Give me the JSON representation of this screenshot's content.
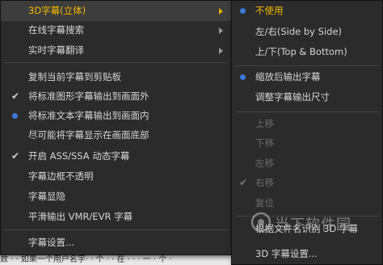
{
  "background_strip": {
    "text": "数 ·   ·   如果一个用户名字·  ·  个   ·   · 在  ·  ·  · 一 · 个 ·"
  },
  "main_menu": {
    "items": [
      {
        "label": "3D字幕(立体)",
        "has_arrow": true,
        "state": "highlighted"
      },
      {
        "label": "在线字幕搜索",
        "has_arrow": true
      },
      {
        "label": "实时字幕翻译",
        "has_arrow": true
      },
      {
        "label": "复制当前字幕到剪贴板"
      },
      {
        "label": "将标准图形字幕输出到画面外",
        "mark": "check"
      },
      {
        "label": "将标准文本字幕输出到画面内",
        "mark": "radio"
      },
      {
        "label": "尽可能将字幕显示在画面底部"
      },
      {
        "label": "开启 ASS/SSA 动态字幕",
        "mark": "check"
      },
      {
        "label": "字幕边框不透明"
      },
      {
        "label": "字幕显隐"
      },
      {
        "label": "平滑输出 VMR/EVR 字幕"
      },
      {
        "label": "字幕设置..."
      }
    ]
  },
  "sub_menu": {
    "items": [
      {
        "label": "不使用",
        "mark": "radio",
        "state": "selected"
      },
      {
        "label": "左/右(Side by Side)"
      },
      {
        "label": "上/下(Top & Bottom)"
      },
      {
        "label": "缩放后输出字幕",
        "mark": "radio"
      },
      {
        "label": "调整字幕输出尺寸"
      },
      {
        "label": "上移",
        "state": "disabled"
      },
      {
        "label": "下移",
        "state": "disabled"
      },
      {
        "label": "左移",
        "state": "disabled"
      },
      {
        "label": "右移",
        "state": "disabled",
        "mark": "check"
      },
      {
        "label": "复位",
        "state": "disabled"
      },
      {
        "label": "根据文件名识别 3D 字幕"
      },
      {
        "label": "3D 字幕设置..."
      }
    ]
  },
  "watermark": {
    "text": "当下软件园"
  },
  "colors": {
    "menu_bg": "#2b2b2b",
    "highlight_text": "#f5b800",
    "radio_blue": "#3d7ad8",
    "disabled_text": "#6b6b6b"
  }
}
